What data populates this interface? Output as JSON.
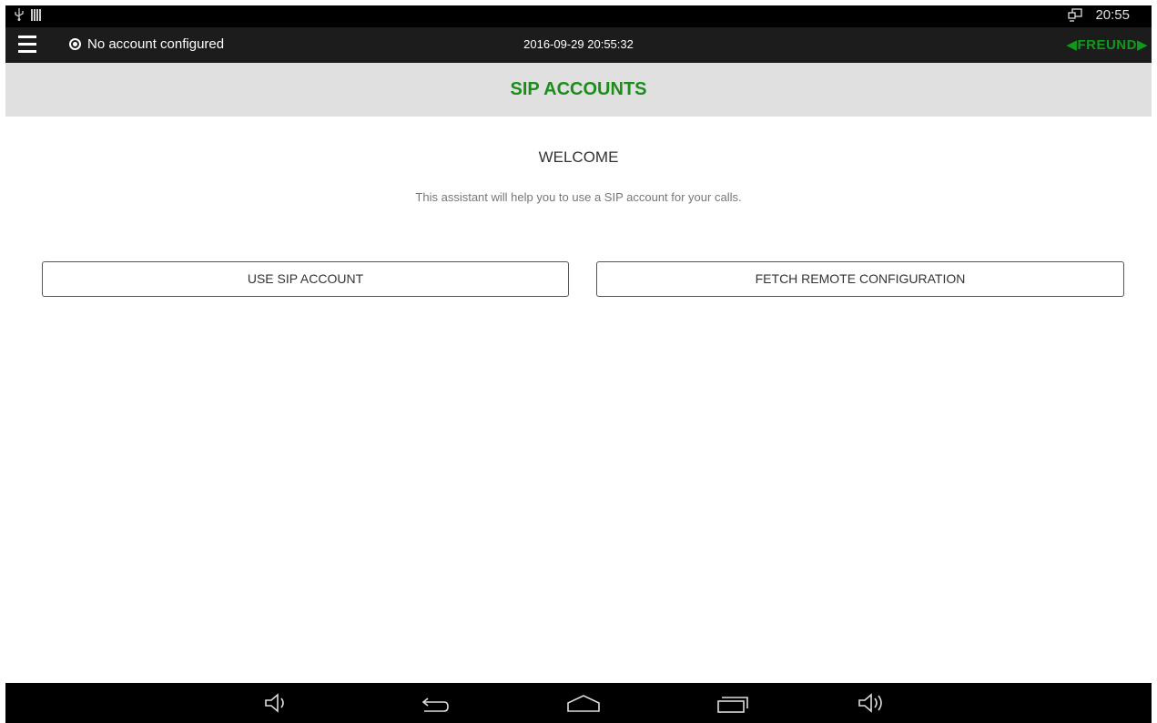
{
  "status_bar": {
    "time": "20:55",
    "icons": [
      "usb-icon",
      "signal-bars-icon",
      "screen-mirror-icon"
    ]
  },
  "app_bar": {
    "account_status": "No account configured",
    "datetime": "2016-09-29 20:55:32",
    "brand": "◀FREUND▶",
    "brand_color": "#0f9a1a"
  },
  "page": {
    "title": "SIP ACCOUNTS",
    "title_color": "#1a8d1a"
  },
  "welcome": {
    "heading": "WELCOME",
    "description": "This assistant will help you to use a SIP account for your calls."
  },
  "buttons": {
    "use_sip": "USE SIP ACCOUNT",
    "fetch_remote": "FETCH REMOTE CONFIGURATION"
  },
  "nav_bar": {
    "icons": [
      "volume-down-icon",
      "back-icon",
      "home-icon",
      "recents-icon",
      "volume-up-icon"
    ]
  }
}
